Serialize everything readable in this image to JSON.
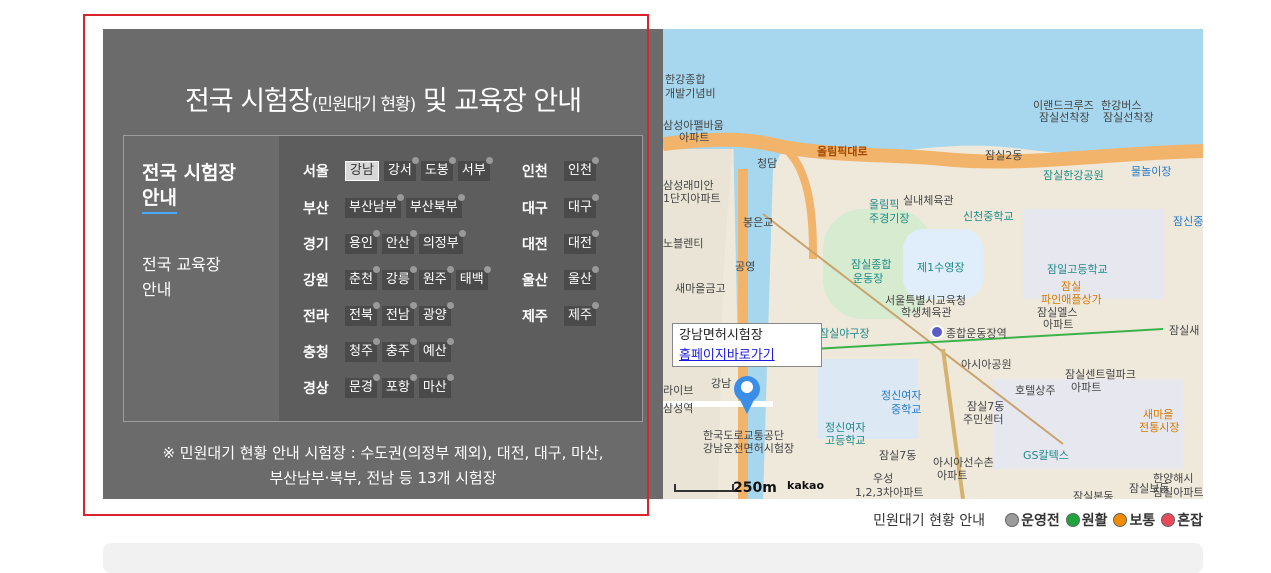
{
  "panel": {
    "title_main": "전국 시험장",
    "title_small": "(민원대기 현황)",
    "title_rest": " 및 교육장 안내",
    "menu": {
      "selected_line1": "전국 시험장",
      "selected_line2": "안내",
      "other_line1": "전국 교육장",
      "other_line2": "안내"
    },
    "note_line1": "※ 민원대기 현황 안내 시험장 : 수도권(의정부 제외), 대전, 대구, 마산,",
    "note_line2": "부산남부·북부, 전남 등 13개 시험장"
  },
  "regions": [
    {
      "name": "서울",
      "centers": [
        "강남",
        "강서",
        "도봉",
        "서부"
      ]
    },
    {
      "name": "부산",
      "centers": [
        "부산남부",
        "부산북부"
      ]
    },
    {
      "name": "경기",
      "centers": [
        "용인",
        "안산",
        "의정부"
      ]
    },
    {
      "name": "강원",
      "centers": [
        "춘천",
        "강릉",
        "원주",
        "태백"
      ]
    },
    {
      "name": "전라",
      "centers": [
        "전북",
        "전남",
        "광양"
      ]
    },
    {
      "name": "충청",
      "centers": [
        "청주",
        "충주",
        "예산"
      ]
    },
    {
      "name": "경상",
      "centers": [
        "문경",
        "포항",
        "마산"
      ]
    },
    {
      "name": "인천",
      "centers": [
        "인천"
      ]
    },
    {
      "name": "대구",
      "centers": [
        "대구"
      ]
    },
    {
      "name": "대전",
      "centers": [
        "대전"
      ]
    },
    {
      "name": "울산",
      "centers": [
        "울산"
      ]
    },
    {
      "name": "제주",
      "centers": [
        "제주"
      ]
    }
  ],
  "selected_center": "강남",
  "map": {
    "popup_title": "강남면허시험장",
    "popup_link": "홈페이지바로가기",
    "scale": "250m",
    "provider": "kakao",
    "labels": [
      "한강종합",
      "개발기념비",
      "삼성아펠바움",
      "아파트",
      "청담",
      "올림픽대로",
      "잠실2동",
      "이랜드크루즈",
      "잠실선착장",
      "한강버스",
      "잠실선착장",
      "잠실한강공원",
      "물놀이장",
      "삼성래미안",
      "1단지아파트",
      "실내체육관",
      "올림픽",
      "주경기장",
      "신천중학교",
      "잠신중",
      "봉은교",
      "노블렌티",
      "공영",
      "잠실종합",
      "운동장",
      "제1수영장",
      "잠일고등학교",
      "잠실",
      "파인애플상가",
      "새마을금고",
      "서울특별시교육청",
      "학생체육관",
      "잠실엘스",
      "아파트",
      "잠실야구장",
      "종합운동장역",
      "잠실새",
      "아시아공원",
      "잠실센트럴파크",
      "아파트",
      "호텔상주",
      "라이브",
      "강남",
      "삼성역",
      "정신여자",
      "중학교",
      "잠실7동",
      "주민센터",
      "새마을",
      "전통시장",
      "한국도로교통공단",
      "강남운전면허시험장",
      "정신여자",
      "고등학교",
      "잠실7동",
      "아시아선수촌",
      "아파트",
      "GS칼텍스",
      "한양해시",
      "잠실아파트",
      "우성",
      "1,2,3차아파트",
      "잠실본동",
      "잠실보동"
    ]
  },
  "legend": {
    "label": "민원대기 현황 안내",
    "items": [
      {
        "label": "운영전",
        "color": "#9b9b9b"
      },
      {
        "label": "원활",
        "color": "#1fa33b"
      },
      {
        "label": "보통",
        "color": "#f08c00"
      },
      {
        "label": "혼잡",
        "color": "#e84a5a"
      }
    ]
  },
  "colors": {
    "panel_bg": "#6b6b6b",
    "highlight_frame": "#d9232d",
    "river": "#a6d7ee",
    "expressway": "#f2b36b"
  }
}
